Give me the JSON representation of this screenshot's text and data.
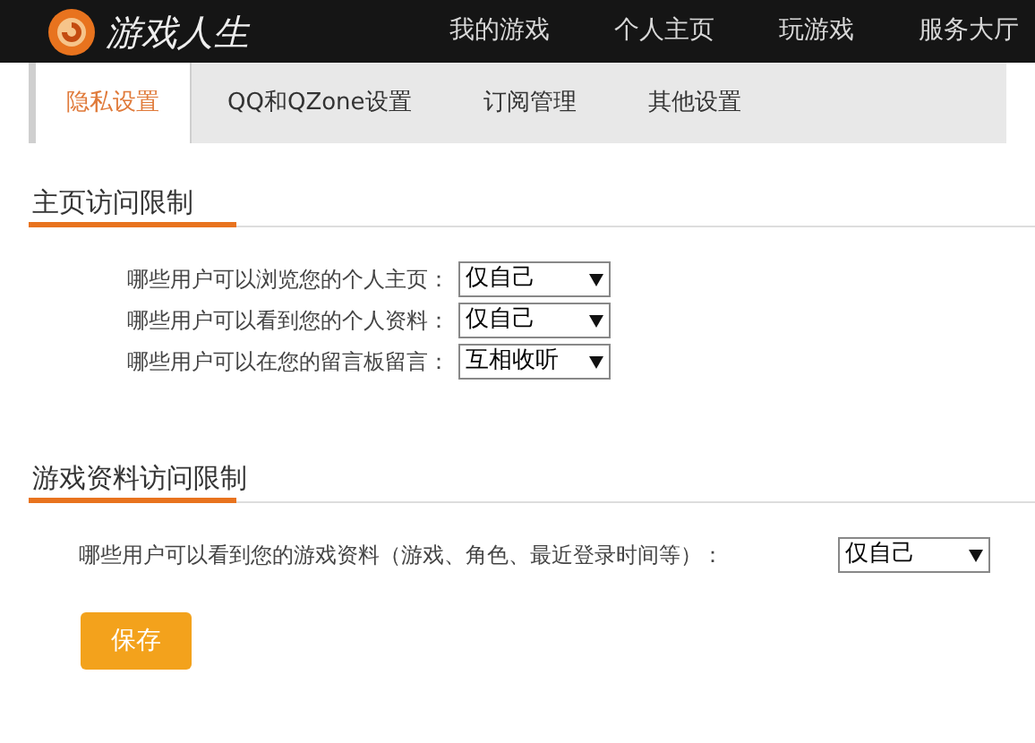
{
  "header": {
    "logo_text": "游戏人生",
    "nav": [
      {
        "label": "我的游戏"
      },
      {
        "label": "个人主页"
      },
      {
        "label": "玩游戏"
      },
      {
        "label": "服务大厅"
      }
    ]
  },
  "tabs": [
    {
      "label": "隐私设置",
      "selected": true
    },
    {
      "label": "QQ和QZone设置",
      "selected": false
    },
    {
      "label": "订阅管理",
      "selected": false
    },
    {
      "label": "其他设置",
      "selected": false
    }
  ],
  "sections": [
    {
      "title": "主页访问限制",
      "rows": [
        {
          "label": "哪些用户可以浏览您的个人主页：",
          "value": "仅自己"
        },
        {
          "label": "哪些用户可以看到您的个人资料：",
          "value": "仅自己"
        },
        {
          "label": "哪些用户可以在您的留言板留言：",
          "value": "互相收听"
        }
      ]
    },
    {
      "title": "游戏资料访问限制",
      "rows": [
        {
          "label": "哪些用户可以看到您的游戏资料（游戏、角色、最近登录时间等）：",
          "value": "仅自己"
        }
      ]
    }
  ],
  "save_button": "保存"
}
